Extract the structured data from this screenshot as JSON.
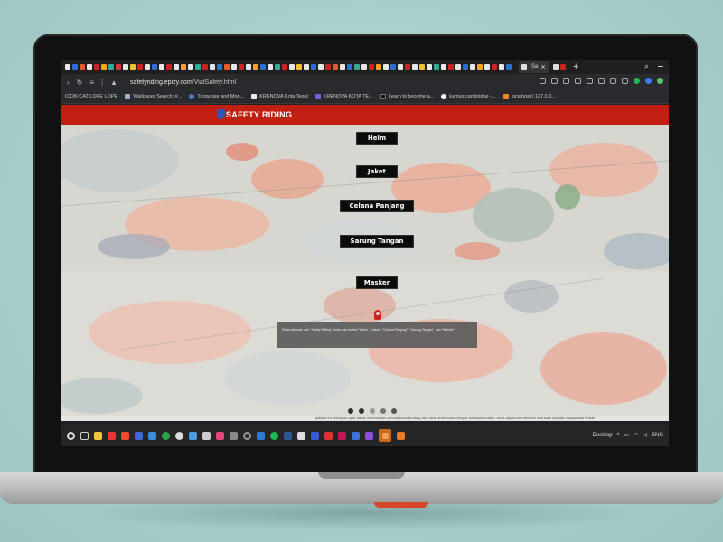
{
  "browser": {
    "active_tab_label": "Sa",
    "url_host": "safetyriding.epizy.com",
    "url_path": "/ViatSafety.html",
    "bookmarks": [
      {
        "label": "ICON CAT LOPE LOPE",
        "color": "#f2b134"
      },
      {
        "label": "Wallpaper Search: #...",
        "color": "#9bb0c8"
      },
      {
        "label": "Turquoise and Mon...",
        "color": "#4a7bd1"
      },
      {
        "label": "KRENOVA Kota Tegal",
        "color": "#e9e9e9"
      },
      {
        "label": "KRENOVA KOTA TE...",
        "color": "#7a5cd6"
      },
      {
        "label": "Learn to become a...",
        "color": "#222222"
      },
      {
        "label": "kamus cambridge -...",
        "color": "#ffffff"
      },
      {
        "label": "localhost / 127.0.0...",
        "color": "#e88a2a"
      }
    ]
  },
  "site": {
    "title": "SAFETY RIDING",
    "header_color": "#c01f12",
    "menu": [
      "Helm",
      "Jaket",
      "Celana Panjang",
      "Sarung Tangan",
      "Masker"
    ],
    "info_text": "Pada halaman dari \"Safety Riding\" terdiri dari tombol \"Helm\", \"Jaket\", \"Celana Panjang\", \"Sarung Tangan\", dan \"Masker\"",
    "footer_marquee": "aplikasi ini bertujuan agar dapat memberikan pemahaman tentang tata cara berkendara dengan berkeselamatan, serta dapat memberikan informasi kepada masyarakat terkait"
  },
  "taskbar": {
    "desktop_label": "Desktop",
    "language": "ENG"
  }
}
